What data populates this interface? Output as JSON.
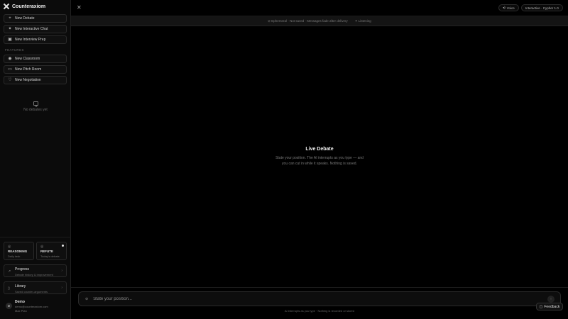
{
  "brand": {
    "name": "Counteraxiom"
  },
  "sidebar": {
    "primary": [
      {
        "label": "New Debate",
        "icon": "plus-icon"
      },
      {
        "label": "New Interactive Chat",
        "icon": "sparkle-icon"
      },
      {
        "label": "New Interview Prep",
        "icon": "briefcase-icon"
      }
    ],
    "section_label": "FEATURES",
    "features": [
      {
        "label": "New Classroom",
        "icon": "eye-icon"
      },
      {
        "label": "New Pitch Room",
        "icon": "presentation-icon"
      },
      {
        "label": "New Negotiation",
        "icon": "heart-icon"
      }
    ],
    "empty_text": "No debates yet",
    "cards": [
      {
        "title": "REASONING",
        "subtitle": "Daily task"
      },
      {
        "title": "REFUTE",
        "subtitle": "Today's debate"
      }
    ],
    "progress": {
      "title": "Progress",
      "subtitle": "Debate history & improvement"
    },
    "library": {
      "title": "Library",
      "subtitle": "Saved counter-arguments"
    },
    "user": {
      "initial": "D",
      "name": "Demo",
      "email": "demo@counteraxiom.com",
      "plan": "Max Plan"
    }
  },
  "topbar": {
    "voice_label": "Voice",
    "mode_label": "Interactive · Cypher 1.0"
  },
  "subbar": {
    "status": "Ephemeral · Not saved · Messages fade after delivery",
    "listening": "Listening"
  },
  "center": {
    "title": "Live Debate",
    "description_line1": "State your position. The AI interrupts as you type — and",
    "description_line2": "you can cut in while it speaks. Nothing is saved."
  },
  "composer": {
    "placeholder": "State your position...",
    "footnote": "AI interrupts as you type · Nothing is recorded or stored"
  },
  "feedback": {
    "label": "Feedback"
  }
}
